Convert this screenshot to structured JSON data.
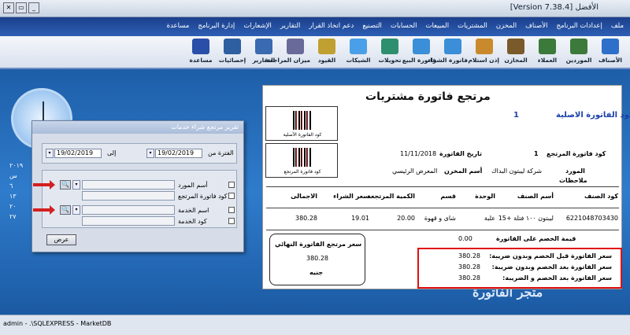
{
  "window": {
    "title": "الأفضل [Version 7.38.4]",
    "close": "✕",
    "restore": "▭",
    "minimize": "_"
  },
  "menu": [
    "ملف",
    "إعدادات البرنامج",
    "الأصناف",
    "المخزن",
    "المشتريات",
    "المبيعات",
    "الحسابات",
    "التصنيع",
    "دعم اتخاذ القرار",
    "التقارير",
    "الإشعارات",
    "إدارة البرنامج",
    "مساعدة"
  ],
  "toolbar": [
    {
      "label": "الأصناف",
      "color": "#2e6fc9"
    },
    {
      "label": "الموردين",
      "color": "#3b7a3b"
    },
    {
      "label": "العملاء",
      "color": "#3b7a3b"
    },
    {
      "label": "المخازن",
      "color": "#7a5a2a"
    },
    {
      "label": "إذن استلام",
      "color": "#c98a2e"
    },
    {
      "label": "فاتورة الشراء",
      "color": "#3a8fd8"
    },
    {
      "label": "فاتورة البيع",
      "color": "#3a8fd8"
    },
    {
      "label": "تحويلات",
      "color": "#2e8f6f"
    },
    {
      "label": "الشيكات",
      "color": "#4aa0e8"
    },
    {
      "label": "القيود",
      "color": "#c0a030"
    },
    {
      "label": "ميزان المراجعة",
      "color": "#6a6a9a"
    },
    {
      "label": "التقارير",
      "color": "#3a6ab0"
    },
    {
      "label": "إحصائيات",
      "color": "#2e5fa0"
    },
    {
      "label": "مساعدة",
      "color": "#2a4fa8"
    }
  ],
  "calendar": {
    "year": "٢٠١٩",
    "day_label": "س",
    "days": [
      "٦",
      "١٣",
      "٢٠",
      "٢٧"
    ]
  },
  "dialog": {
    "title": "تقرير مرتجع شراء خدمات",
    "period_label": "الفترة من",
    "to_label": "إلى",
    "date_from": "19/02/2019",
    "date_to": "19/02/2019",
    "supplier_label": "أسم المورد",
    "return_code_label": "كود فاتورة المرتجع",
    "service_name_label": "اسم الخدمة",
    "service_code_label": "كود الخدمة",
    "show_button": "عرض",
    "search_icon": "🔍",
    "dropdown_icon": "▾"
  },
  "report": {
    "title": "مرتجع فاتورة مشتريات",
    "original_invoice_label": "كود الفاتورة الاصلية",
    "original_invoice_value": "1",
    "barcode1_caption": "كود الفاتورة الأصلية",
    "barcode2_caption": "كود فاتورة المرتجع",
    "return_code_label": "كود فاتورة المرتجع",
    "return_code_value": "1",
    "invoice_date_label": "تاريخ الفاتورة",
    "invoice_date_value": "11/11/2018",
    "supplier_label": "المورد",
    "supplier_value": "شركة ليبتون البداك",
    "store_label": "أسم المخزن",
    "store_value": "المعرض الرئيسي",
    "notes_label": "ملاحظات",
    "table": {
      "headers": [
        "كود الصنف",
        "أسم الصنف",
        "الوحدة",
        "قسم",
        "الكمية المرتجعة",
        "سعر الشراء",
        "الاجمالى"
      ],
      "rows": [
        [
          "6221048703430",
          "ليبتون ١٠٠ فتلة +15",
          "علبة",
          "شاى و قهوة",
          "20.00",
          "19.01",
          "380.28"
        ]
      ]
    },
    "discount_label": "قيمة الخصم على الفاتورة",
    "discount_value": "0.00",
    "final_box_title": "سعر مرتجع الفاتورة النهائي",
    "final_box_value": "380.28",
    "final_box_currency": "جنيه",
    "totals": [
      {
        "label": "سعر الفاتورة قبل الخصم وبدون ضريبة:",
        "value": "380.28"
      },
      {
        "label": "سعر الفاتورة بعد الخصم وبدون ضريبة:",
        "value": "380.28"
      },
      {
        "label": "سعر الفاتورة بعد الخصم و الضريبة:",
        "value": "380.28"
      }
    ]
  },
  "status": {
    "text": "admin  -  .\\SQLEXPRESS  -  MarketDB"
  }
}
